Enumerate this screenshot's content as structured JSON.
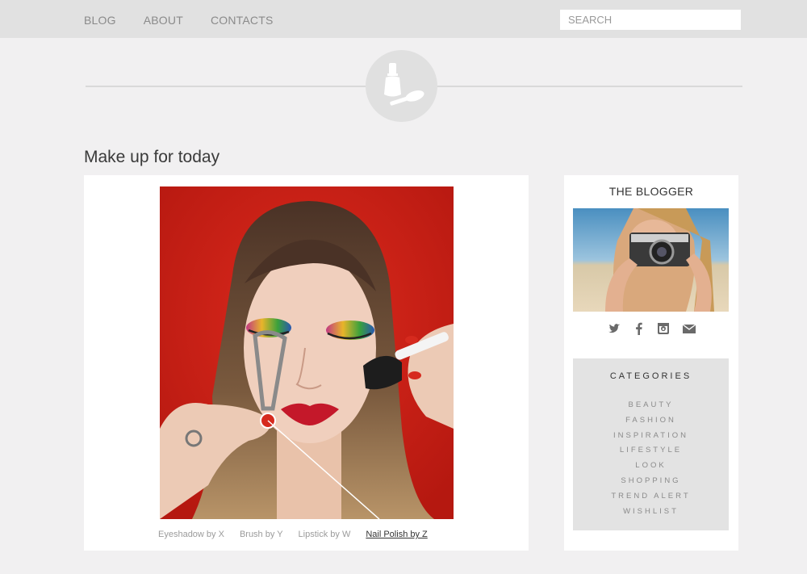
{
  "nav": {
    "items": [
      "BLOG",
      "ABOUT",
      "CONTACTS"
    ]
  },
  "search": {
    "placeholder": "SEARCH"
  },
  "post": {
    "title": "Make up for today",
    "captions": [
      "Eyeshadow by X",
      "Brush by Y",
      "Lipstick by W"
    ],
    "active_caption": "Nail Polish by Z"
  },
  "sidebar": {
    "title": "THE BLOGGER",
    "social_icons": [
      "twitter-icon",
      "facebook-icon",
      "instagram-icon",
      "mail-icon"
    ],
    "categories_title": "CATEGORIES",
    "categories": [
      "BEAUTY",
      "FASHION",
      "INSPIRATION",
      "LIFESTYLE",
      "LOOK",
      "SHOPPING",
      "TREND ALERT",
      "WISHLIST"
    ]
  },
  "colors": {
    "page_bg": "#f1f0f1",
    "topbar_bg": "#e1e1e1",
    "photo_red": "#c8221a",
    "category_bg": "#e3e3e3"
  }
}
